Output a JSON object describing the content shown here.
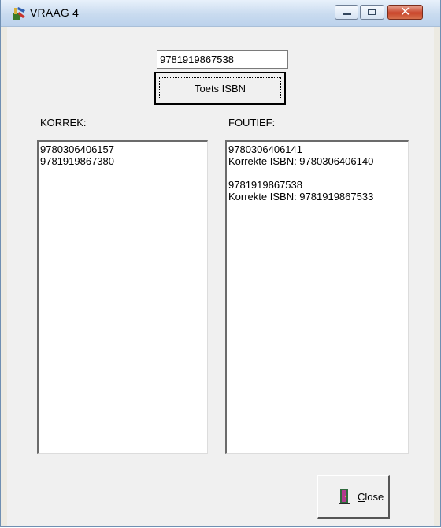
{
  "window": {
    "title": "VRAAG 4",
    "controls": {
      "minimize": "minimize-icon",
      "maximize": "maximize-icon",
      "close": "close-icon"
    }
  },
  "form": {
    "isbn_value": "9781919867538",
    "check_button_label": "Toets ISBN",
    "korrek_label": "KORREK:",
    "foutief_label": "FOUTIEF:",
    "korrek_items": [
      "9780306406157",
      "9781919867380"
    ],
    "foutief_items": [
      "9780306406141",
      "Korrekte ISBN: 9780306406140",
      "",
      "9781919867538",
      "Korrekte ISBN: 9781919867533"
    ],
    "close_button_first_letter": "C",
    "close_button_rest": "lose"
  },
  "colors": {
    "titlebar": "#c9dbef",
    "client_background": "#f0f0f0",
    "close_control": "#c9462b"
  }
}
